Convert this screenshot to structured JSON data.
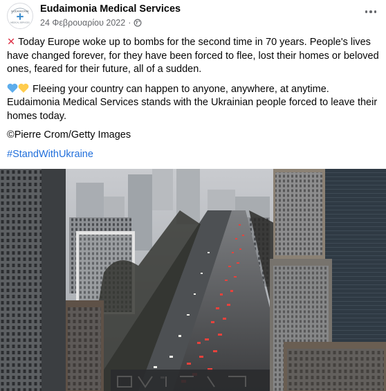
{
  "post": {
    "page_name": "Eudaimonia Medical Services",
    "date": "24 Φεβρουαρίου 2022",
    "separator": "·",
    "avatar_text_top": "EUDAIMONIA",
    "avatar_text_bottom": "MEDICAL SERVICES",
    "paragraph1_lines": [
      "Today Europe woke up to bombs for the second time in 70 years. People's lives",
      "have changed forever, for they have been forced to flee, lost their homes or beloved",
      "ones, feared for their future, all of a sudden."
    ],
    "paragraph2_lines": [
      "Fleeing your country can happen to anyone, anywhere, at anytime.",
      "Eudaimonia Medical Services stands with the Ukrainian people forced to leave their",
      "homes today."
    ],
    "credit": "Pierre Crom/Getty Images",
    "hashtag": "#StandWithUkraine"
  },
  "colors": {
    "link": "#216fdb",
    "meta": "#65676b",
    "heart_blue": "#5dadec",
    "heart_yellow": "#ffcc4d"
  },
  "icons": {
    "more": "more-options-icon",
    "privacy": "globe-icon",
    "cross": "red-cross-icon"
  }
}
